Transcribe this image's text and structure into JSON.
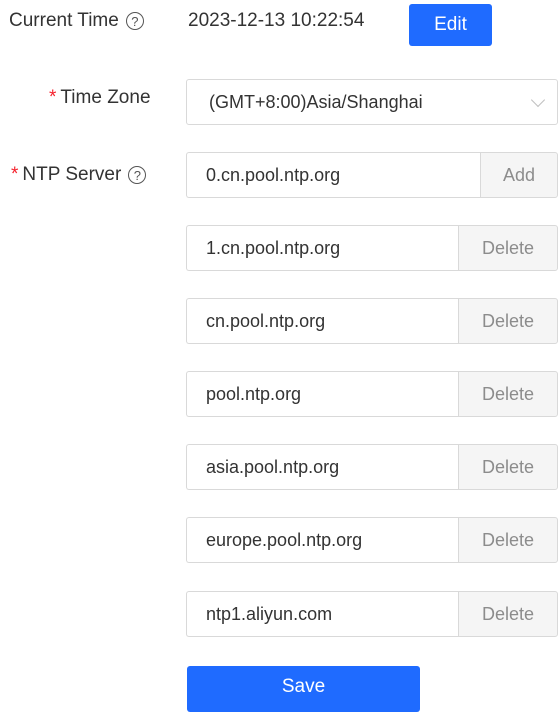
{
  "current_time": {
    "label": "Current Time",
    "help": "?",
    "value": "2023-12-13 10:22:54",
    "edit_label": "Edit"
  },
  "time_zone": {
    "required_mark": "*",
    "label": "Time Zone",
    "selected": "(GMT+8:00)Asia/Shanghai"
  },
  "ntp": {
    "required_mark": "*",
    "label": "NTP Server",
    "help": "?",
    "servers": [
      {
        "value": "0.cn.pool.ntp.org",
        "action": "Add"
      },
      {
        "value": "1.cn.pool.ntp.org",
        "action": "Delete"
      },
      {
        "value": "cn.pool.ntp.org",
        "action": "Delete"
      },
      {
        "value": "pool.ntp.org",
        "action": "Delete"
      },
      {
        "value": "asia.pool.ntp.org",
        "action": "Delete"
      },
      {
        "value": "europe.pool.ntp.org",
        "action": "Delete"
      },
      {
        "value": "ntp1.aliyun.com",
        "action": "Delete"
      }
    ]
  },
  "save_label": "Save",
  "colors": {
    "primary": "#1f6bff",
    "required": "#f5222d",
    "addon_bg": "#f5f5f5",
    "border": "#d9d9d9"
  }
}
